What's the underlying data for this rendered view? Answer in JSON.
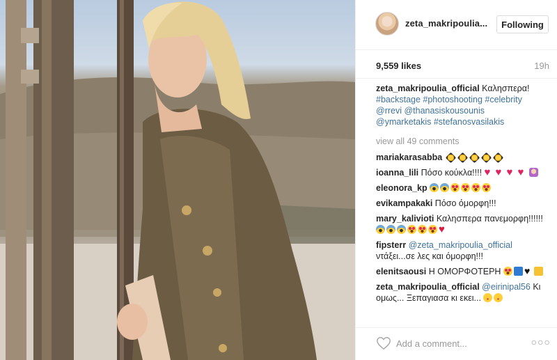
{
  "post": {
    "header": {
      "username": "zeta_makripoulia...",
      "follow_label": "Following"
    },
    "likes": "9,559 likes",
    "time": "19h",
    "caption": {
      "user": "zeta_makripoulia_official",
      "text": "Καλησπερα!",
      "tags_line1": "#backstage #photoshooting #celebrity",
      "tags_line2": "@rrevi @thanasiskousounis",
      "tags_line3": "@ymarketakis #stefanosvasilakis"
    },
    "view_all": "view all 49 comments",
    "comments": [
      {
        "user": "mariakarasabba",
        "text": "",
        "tag": "",
        "emoji": [
          "star",
          "star",
          "star",
          "star",
          "star"
        ]
      },
      {
        "user": "ioanna_lili",
        "text": "Πόσο κούκλα!!!!",
        "tag": "",
        "emoji": [
          "heart",
          "heart",
          "heart",
          "heart",
          "woman"
        ]
      },
      {
        "user": "eleonora_kp",
        "text": "",
        "tag": "",
        "emoji": [
          "scream",
          "scream",
          "hearteyes",
          "hearteyes",
          "hearteyes",
          "hearteyes"
        ]
      },
      {
        "user": "evikampakaki",
        "text": "Πόσο όμορφη!!!",
        "tag": "",
        "emoji": []
      },
      {
        "user": "mary_kaliviotі",
        "text": "Καλησπερα πανεμορφη!!!!!!",
        "tag": "",
        "emoji": [
          "scream",
          "scream",
          "scream",
          "hearteyes",
          "hearteyes",
          "hearteyes",
          "heartbroken"
        ]
      },
      {
        "user": "fipsterr",
        "text": "ντάξει...σε λες και όμορφη!!!",
        "tag": "@zeta_makripoulia_official",
        "emoji": []
      },
      {
        "user": "elenitsaousi",
        "text": "Η ΟΜΟΡΦΟΤΕΡΗ",
        "tag": "",
        "emoji": [
          "hearteyes",
          "blue-sq",
          "black-heart",
          "yellow-sq"
        ]
      },
      {
        "user": "zeta_makripoulia_official",
        "text": "Κι ομως... Ξεπαγιασα κι εκει...",
        "tag": "@eirinipal56",
        "emoji": [
          "blush",
          "blush"
        ]
      }
    ],
    "comment_placeholder": "Add a comment...",
    "more_label": "○○○"
  },
  "colors": {
    "link": "#3f729b",
    "muted": "#999999",
    "heart": "#e0245e",
    "border": "#efefef"
  }
}
